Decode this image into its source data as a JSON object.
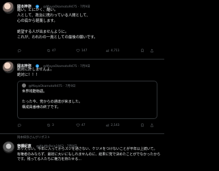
{
  "tweet1": {
    "name": "岡本梓弥",
    "handle": "@MayaOkamoto9475 · 7月9日",
    "text": "酷い。とにかく、酷い。\n人として、政治に携わっている人間として、\n心の底から軽蔑します。\n\n絶望する人が出ませんように。\nこれが、われわの一員としての最後の願いです。",
    "actions": {
      "reply": "",
      "retweet": "47",
      "like": "147",
      "views": "4,711"
    }
  },
  "tweet2": {
    "name": "岡本梓弥",
    "handle": "@MayaOkamoto9475 · 7月9日",
    "text": "絶対に許しませんよ。\n絶対に！！！",
    "quote": {
      "handle": "@MayaOkamoto9475 · 7月9日",
      "text": "世界残酷物語。\n\nたった今、党からの通達が来ました。\n構成員番様の終了です。"
    },
    "actions": {
      "reply": "",
      "retweet": "3",
      "like": "47",
      "views": "2,143"
    }
  },
  "retweet_note": "岡本梓弥さんがリポスト",
  "tweet3": {
    "name": "宿橋紀恵",
    "handle": "@KtuMsRein1962 · 7月9日",
    "text": "ありえない。今年に入ってからスジを通さない、ケジメをつけないことが平年以上続いて。\n有権者のみならず、最初に大いにもしれませんのに、結果に党で決めたことがでなかったからです。残ってる人たちに権力を持たせる..."
  }
}
